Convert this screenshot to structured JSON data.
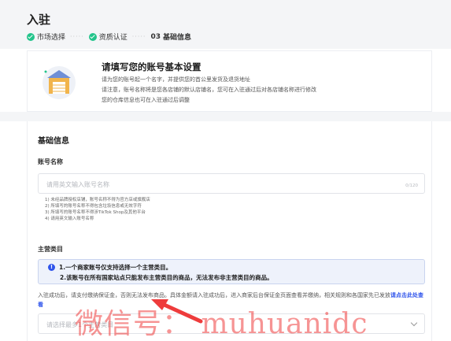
{
  "page": {
    "title": "入驻"
  },
  "steps": [
    {
      "label": "市场选择",
      "status": "done"
    },
    {
      "label": "资质认证",
      "status": "done"
    },
    {
      "number": "03",
      "label": "基础信息",
      "status": "current"
    }
  ],
  "info": {
    "title": "请填写您的账号基本设置",
    "lines": [
      "请为您的账号起一个名字，并提供您的首公里发货及退货地址",
      "请注意，账号名称将是您各店铺的默认店铺名，您可在入驻通过后对各店铺名称进行修改",
      "您的仓库信息也可在入驻通过后调整"
    ]
  },
  "form": {
    "section_title": "基础信息",
    "account_name": {
      "label": "账号名称",
      "placeholder": "请用英文输入账号名称",
      "counter": "0/120",
      "rules": [
        "1) 未经品牌授权店铺，账号名称不得为官方店或旗舰店",
        "2) 所填写的账号名称不得包含垃圾信息或无效字符",
        "3) 所填写的账号名称不得涉TikTok Shop及其他平台",
        "4) 请用英文输入账号名称"
      ]
    },
    "main_category": {
      "label": "主营类目",
      "notice_lines": [
        "1.一个商家账号仅支持选择一个主营类目。",
        "2.该账号在所有国家站点只能发布主营类目的商品，无法发布非主营类目的商品。"
      ],
      "paragraph": "入驻成功后，请支付缴纳保证金，否则无法发布商品。具体金额请入驻成功后，进入商家后台保证金页面查看并缴纳，相关规则和各国家先已发放",
      "link_label": "请点击此处查看",
      "placeholder": "请选择最多1个主营类目"
    }
  },
  "watermark": {
    "text": "微信号： muhuanidc",
    "color": "#ee3c3c"
  },
  "colors": {
    "accent": "#2f54eb",
    "success": "#23c48b",
    "page_bg": "#f4f5f7"
  }
}
